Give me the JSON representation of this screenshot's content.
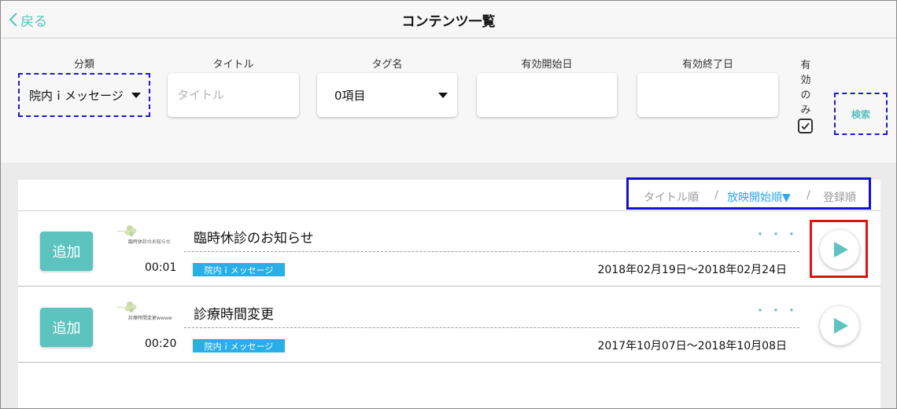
{
  "header": {
    "back_label": "戻る",
    "title": "コンテンツ一覧"
  },
  "filters": {
    "category": {
      "label": "分類",
      "value": "院内ｉメッセージ"
    },
    "title_field": {
      "label": "タイトル",
      "placeholder": "タイトル",
      "value": ""
    },
    "tag": {
      "label": "タグ名",
      "value": "0項目"
    },
    "start_date": {
      "label": "有効開始日",
      "value": ""
    },
    "end_date": {
      "label": "有効終了日",
      "value": ""
    },
    "valid_only": {
      "label_chars": [
        "有",
        "効",
        "の",
        "み"
      ],
      "checked": true
    },
    "search_label": "検索"
  },
  "sort": {
    "options": [
      "タイトル順",
      "放映開始順▼",
      "登録順"
    ],
    "separator": "/",
    "active_index": 1
  },
  "items": [
    {
      "add_label": "追加",
      "thumb_text": "臨時休診のお知らせ",
      "duration": "00:01",
      "title": "臨時休診のお知らせ",
      "more": "・・・",
      "tag": "院内ｉメッセージ",
      "period": "2018年02月19日〜2018年02月24日"
    },
    {
      "add_label": "追加",
      "thumb_text": "診療時間変更wwww",
      "duration": "00:20",
      "title": "診療時間変更",
      "more": "・・・",
      "tag": "院内ｉメッセージ",
      "period": "2017年10月07日〜2018年10月08日"
    }
  ],
  "colors": {
    "accent_teal": "#5cc3bf",
    "tag_blue": "#29aee8",
    "annotation_blue": "#1010d0",
    "annotation_red": "#e01010"
  }
}
